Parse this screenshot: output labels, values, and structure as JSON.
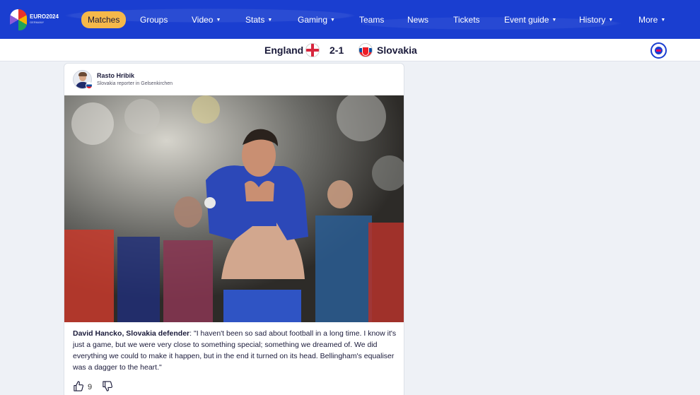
{
  "nav": {
    "logo_text": "EURO2024",
    "logo_subtext": "GERMANY",
    "items": [
      {
        "label": "Matches",
        "active": true,
        "dropdown": false
      },
      {
        "label": "Groups",
        "active": false,
        "dropdown": false
      },
      {
        "label": "Video",
        "active": false,
        "dropdown": true
      },
      {
        "label": "Stats",
        "active": false,
        "dropdown": true
      },
      {
        "label": "Gaming",
        "active": false,
        "dropdown": true
      },
      {
        "label": "Teams",
        "active": false,
        "dropdown": false
      },
      {
        "label": "News",
        "active": false,
        "dropdown": false
      },
      {
        "label": "Tickets",
        "active": false,
        "dropdown": false
      },
      {
        "label": "Event guide",
        "active": false,
        "dropdown": true
      },
      {
        "label": "History",
        "active": false,
        "dropdown": true
      },
      {
        "label": "More",
        "active": false,
        "dropdown": true
      }
    ],
    "caret": "▼"
  },
  "match": {
    "home": "England",
    "away": "Slovakia",
    "score": "2-1"
  },
  "post": {
    "author_name": "Rasto Hribik",
    "author_role": "Slovakia reporter in Gelsenkirchen",
    "quote_speaker": "David Hancko, Slovakia defender",
    "quote_text": ": \"I haven't been so sad about football in a long time. I know it's just a game, but we were very close to something special; something we dreamed of. We did everything we could to make it happen, but in the end it turned on its head. Bellingham's equaliser was a dagger to the heart.\"",
    "likes": "9"
  },
  "colors": {
    "nav_bg": "#1a3ed0",
    "active_pill": "#f5b84a",
    "page_bg": "#eef1f6"
  }
}
